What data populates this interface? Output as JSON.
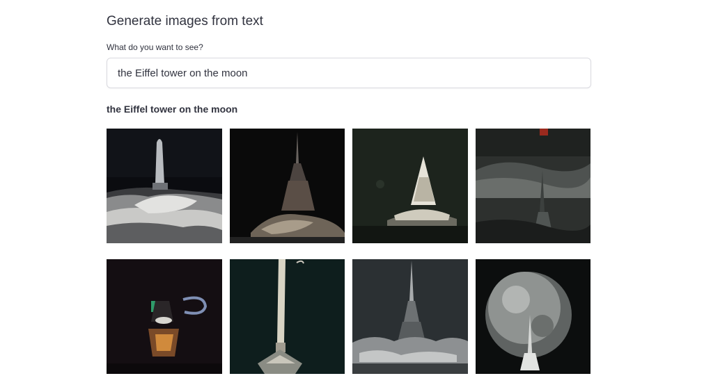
{
  "page": {
    "title": "Generate images from text",
    "input_label": "What do you want to see?",
    "input_value": "the Eiffel tower on the moon",
    "result_caption": "the Eiffel tower on the moon"
  },
  "images": [
    {
      "id": "generated-image-1"
    },
    {
      "id": "generated-image-2"
    },
    {
      "id": "generated-image-3"
    },
    {
      "id": "generated-image-4"
    },
    {
      "id": "generated-image-5"
    },
    {
      "id": "generated-image-6"
    },
    {
      "id": "generated-image-7"
    },
    {
      "id": "generated-image-8"
    }
  ]
}
